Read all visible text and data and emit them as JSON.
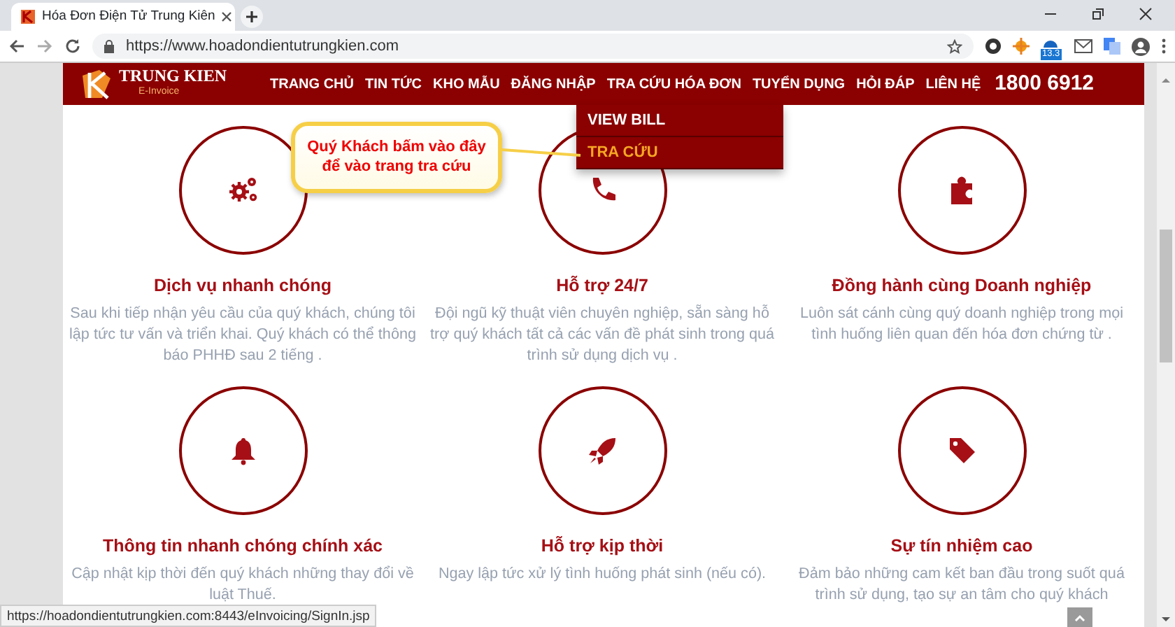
{
  "browser": {
    "tab": {
      "title": "Hóa Đơn Điện Tử Trung Kiên"
    },
    "url": "https://www.hoadondientutrungkien.com",
    "extension_badge": "13.3",
    "status_url": "https://hoadondientutrungkien.com:8443/eInvoicing/SignIn.jsp"
  },
  "site": {
    "logo": {
      "name": "TRUNG KIEN",
      "tagline": "E-Invoice"
    },
    "nav": [
      "TRANG CHỦ",
      "TIN TỨC",
      "KHO MẪU",
      "ĐĂNG NHẬP",
      "TRA CỨU HÓA ĐƠN",
      "TUYỂN DỤNG",
      "HỎI ĐÁP",
      "LIÊN HỆ"
    ],
    "hotline": "1800 6912",
    "dropdown": [
      {
        "label": "VIEW BILL",
        "selected": false
      },
      {
        "label": "TRA CỨU",
        "selected": true
      }
    ],
    "callout": [
      "Quý Khách bấm vào đây",
      "để vào trang tra cứu"
    ],
    "features": [
      {
        "title": "Dịch vụ nhanh chóng",
        "text": "Sau khi tiếp nhận yêu cầu của quý khách, chúng tôi lập tức tư vấn và triển khai. Quý khách có thể thông báo PHHĐ sau 2 tiếng ."
      },
      {
        "title": "Hỗ trợ 24/7",
        "text": "Đội ngũ kỹ thuật viên chuyên nghiệp, sẵn sàng hỗ trợ quý khách tất cả các vấn đề phát sinh trong quá trình sử dụng dịch vụ ."
      },
      {
        "title": "Đồng hành cùng Doanh nghiệp",
        "text": "Luôn sát cánh cùng quý doanh nghiệp trong mọi tình huống liên quan đến hóa đơn chứng từ ."
      },
      {
        "title": "Thông tin nhanh chóng chính xác",
        "text": "Cập nhật kịp thời đến quý khách những thay đổi về luật Thuế."
      },
      {
        "title": "Hỗ trợ kịp thời",
        "text": "Ngay lập tức xử lý tình huống phát sinh (nếu có)."
      },
      {
        "title": "Sự tín nhiệm cao",
        "text": "Đảm bảo những cam kết ban đầu trong suốt quá trình sử dụng, tạo sự an tâm cho quý khách"
      }
    ]
  }
}
